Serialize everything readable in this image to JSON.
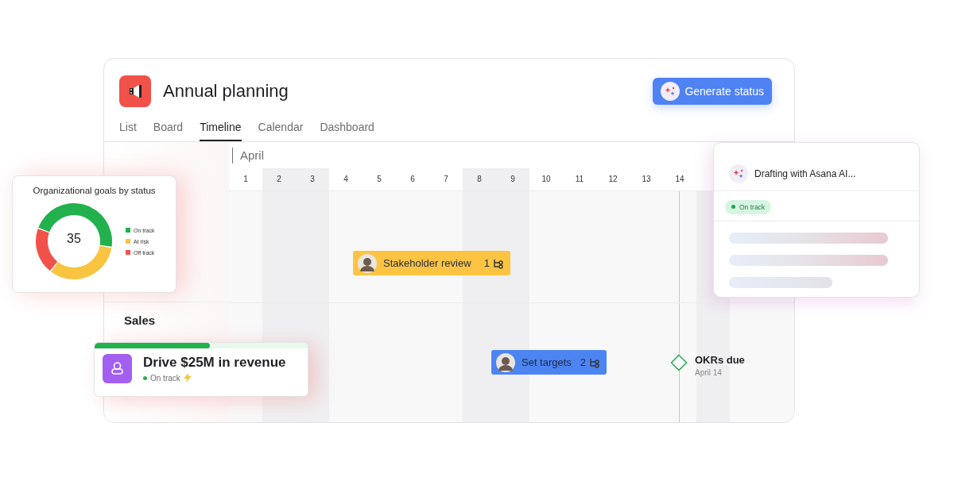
{
  "project": {
    "title": "Annual planning"
  },
  "generate_button": {
    "label": "Generate status"
  },
  "tabs": [
    {
      "label": "List",
      "selected": false
    },
    {
      "label": "Board",
      "selected": false
    },
    {
      "label": "Timeline",
      "selected": true
    },
    {
      "label": "Calendar",
      "selected": false
    },
    {
      "label": "Dashboard",
      "selected": false
    }
  ],
  "timeline": {
    "month": "April",
    "days": [
      {
        "label": "1",
        "shaded": false
      },
      {
        "label": "2",
        "shaded": true
      },
      {
        "label": "3",
        "shaded": true
      },
      {
        "label": "4",
        "shaded": false
      },
      {
        "label": "5",
        "shaded": false
      },
      {
        "label": "6",
        "shaded": false
      },
      {
        "label": "7",
        "shaded": false
      },
      {
        "label": "8",
        "shaded": true
      },
      {
        "label": "9",
        "shaded": true
      },
      {
        "label": "10",
        "shaded": false
      },
      {
        "label": "11",
        "shaded": false
      },
      {
        "label": "12",
        "shaded": false
      },
      {
        "label": "13",
        "shaded": false
      },
      {
        "label": "14",
        "shaded": false
      }
    ],
    "sections": [
      {
        "tasks": [
          {
            "name": "Stakeholder review",
            "count": "1",
            "color": "#fdc443"
          }
        ]
      },
      {
        "title": "Sales",
        "tasks": [
          {
            "name": "Set targets",
            "count": "2",
            "color": "#4c84f2"
          }
        ],
        "milestone": {
          "name": "OKRs due",
          "date": "April 14"
        }
      }
    ]
  },
  "goals_chart": {
    "title": "Organizational goals by status",
    "total": "35",
    "legend": [
      {
        "label": "On track",
        "color": "#22b14c"
      },
      {
        "label": "At risk",
        "color": "#f9c440"
      },
      {
        "label": "Off track",
        "color": "#f0524a"
      }
    ]
  },
  "drafting_card": {
    "title": "Drafting with Asana AI...",
    "status": "On track"
  },
  "goal_card": {
    "title": "Drive $25M in revenue",
    "status": "On track",
    "level": 0.54
  }
}
